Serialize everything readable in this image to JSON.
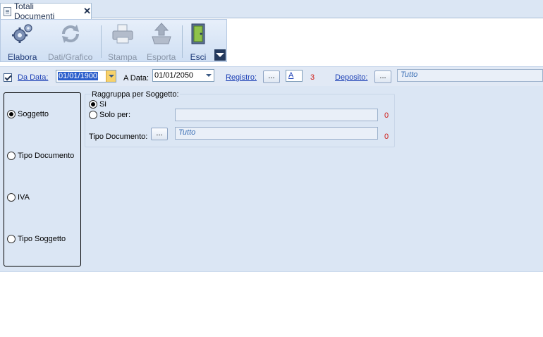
{
  "tab": {
    "title": "Totali Documenti",
    "close": "✕"
  },
  "toolbar": {
    "elabora": "Elabora",
    "dati_grafico": "Dati/Grafico",
    "stampa": "Stampa",
    "esporta": "Esporta",
    "esci": "Esci"
  },
  "filters": {
    "da_data_label": "Da Data:",
    "da_data_value": "01/01/1900",
    "a_data_label": "A Data:",
    "a_data_value": "01/01/2050",
    "registro_label": "Registro:",
    "registro_button": "...",
    "registro_value": "A",
    "registro_count": "3",
    "deposito_label": "Deposito:",
    "deposito_button": "...",
    "deposito_value": "Tutto"
  },
  "grouping": {
    "options": [
      "Soggetto",
      "Tipo Documento",
      "IVA",
      "Tipo Soggetto"
    ],
    "selected": "Soggetto"
  },
  "raggruppa": {
    "title": "Raggruppa per Soggetto:",
    "si_label": "Si",
    "solo_per_label": "Solo per:",
    "solo_per_value": "",
    "solo_per_count": "0",
    "tipo_documento_label": "Tipo Documento:",
    "tipo_documento_button": "...",
    "tipo_documento_value": "Tutto",
    "tipo_documento_count": "0"
  },
  "colors": {
    "accent": "#1b3fb5",
    "panel": "#dbe6f4",
    "count_red": "#d0201a"
  }
}
